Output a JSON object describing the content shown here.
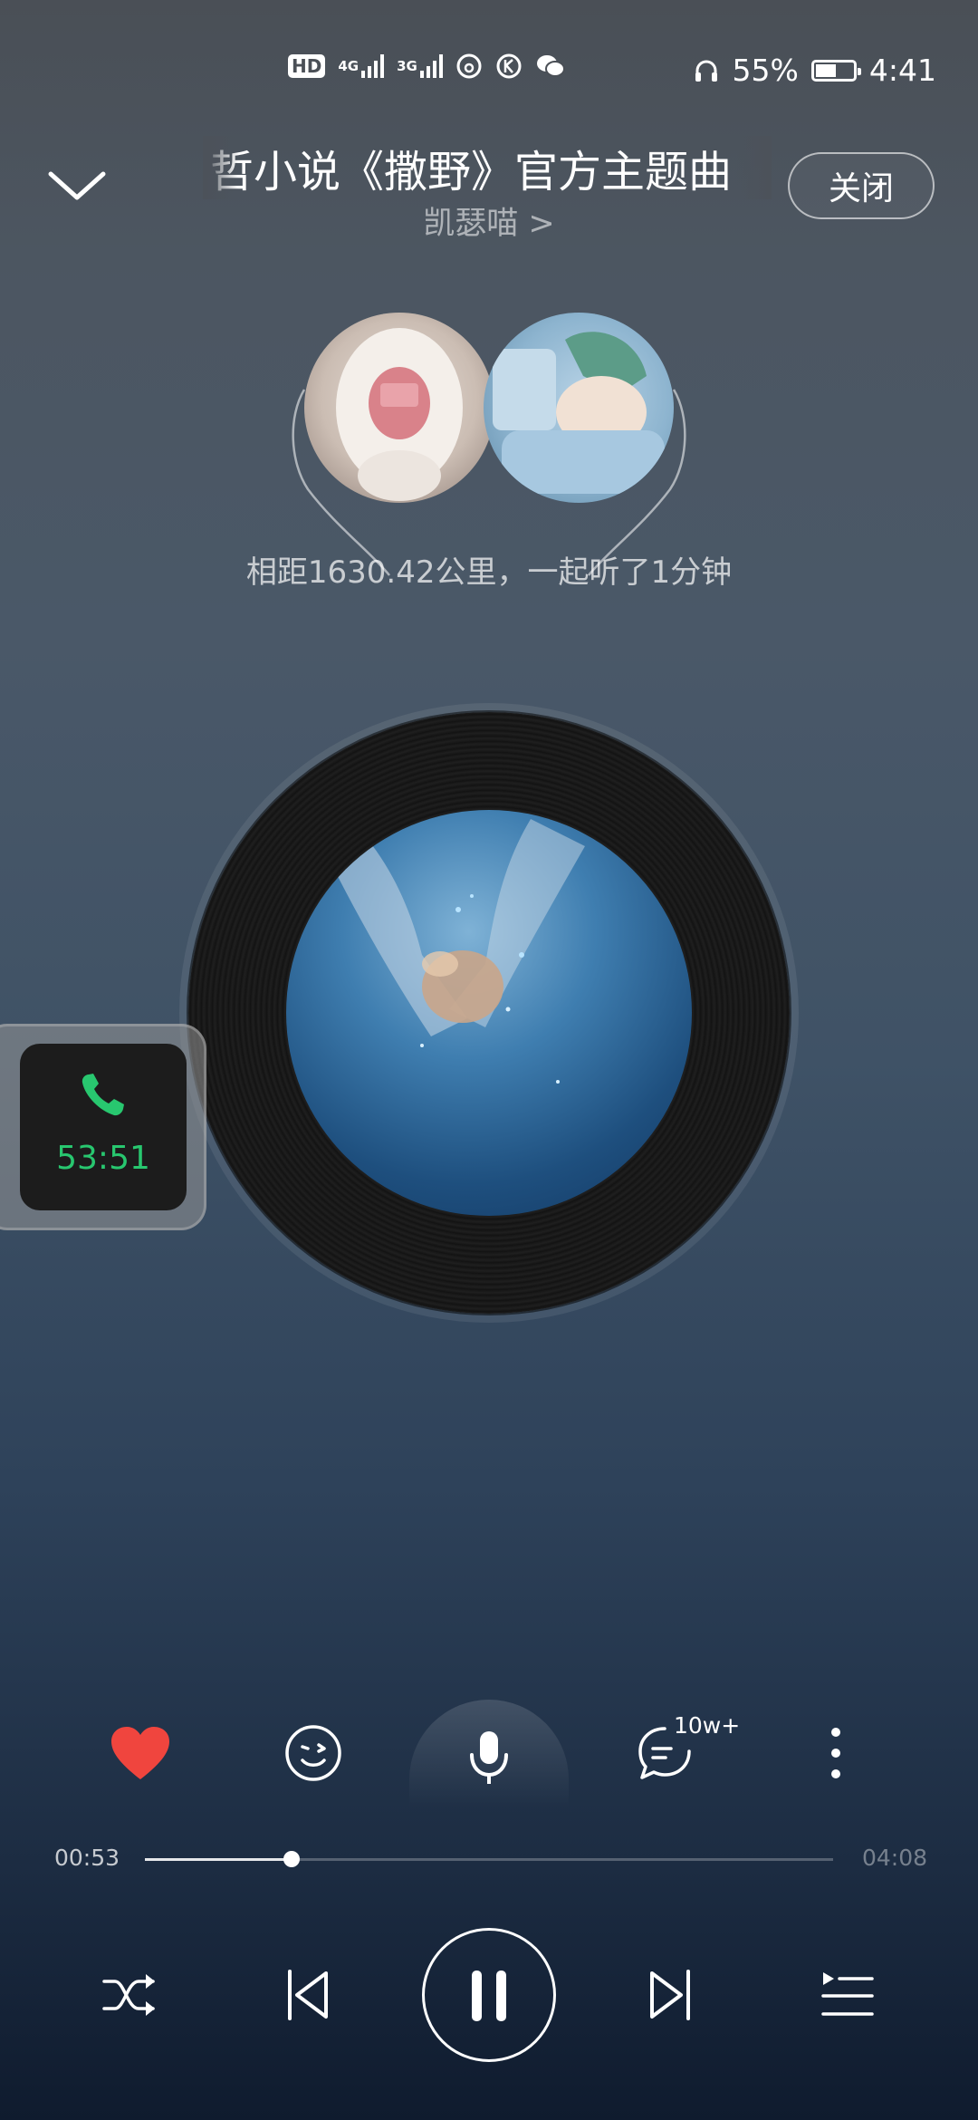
{
  "status_bar": {
    "hd_label": "HD",
    "net1": "4G",
    "net2": "3G",
    "battery_percent": "55%",
    "battery_level": 0.55,
    "time": "4:41",
    "icons": [
      "hd-icon",
      "sim-icon",
      "signal-4g-icon",
      "signal-3g-icon",
      "netease-music-icon",
      "k-icon",
      "wechat-icon",
      "headphones-icon",
      "battery-icon"
    ]
  },
  "header": {
    "title": "哲小说《撒野》官方主题曲",
    "artist": "凯瑟喵 >",
    "close_label": "关闭"
  },
  "together": {
    "text": "相距1630.42公里，一起听了1分钟"
  },
  "call_widget": {
    "duration": "53:51",
    "accent": "#28c76f"
  },
  "actions": {
    "comment_count": "10w+",
    "like_color": "#f0453e"
  },
  "progress": {
    "current": "00:53",
    "total": "04:08",
    "fraction": 0.2137
  }
}
